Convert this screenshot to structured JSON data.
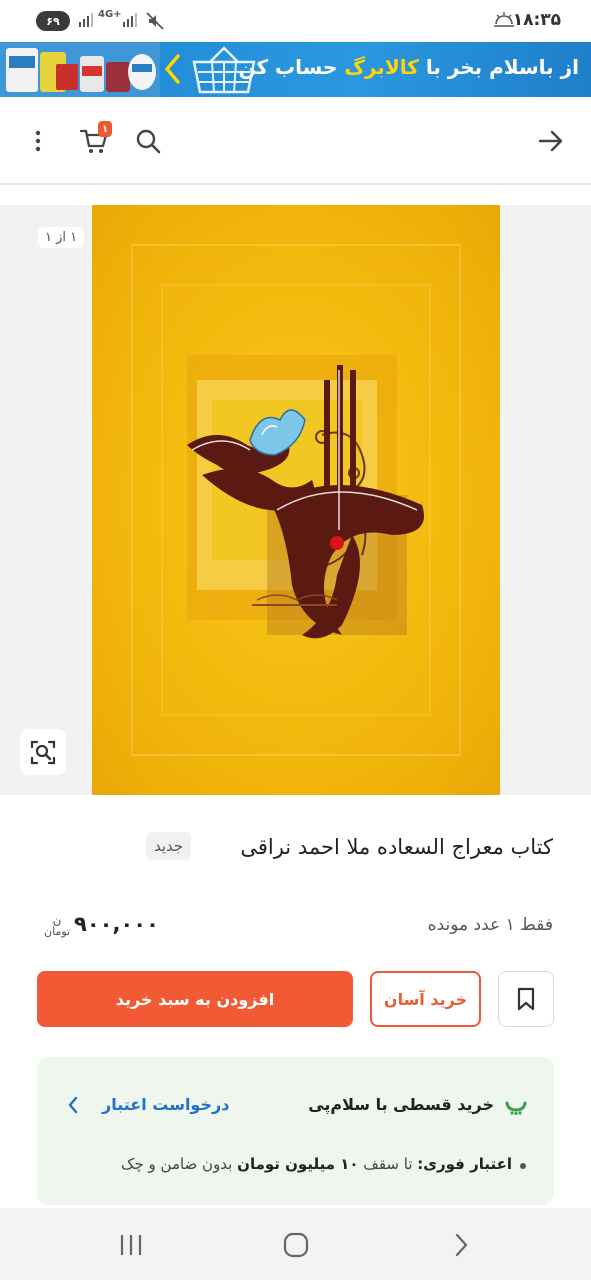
{
  "status_bar": {
    "time": "۱۸:۳۵",
    "battery": "۶۹",
    "network": "4G+"
  },
  "banner": {
    "text_prefix": "از باسلام بخر با ",
    "text_highlight": "کالابرگ",
    "text_suffix": " حساب کن"
  },
  "app_bar": {
    "cart_count": "۱"
  },
  "gallery": {
    "counter": "۱ از ۱"
  },
  "product": {
    "title": "کتاب معراج السعاده ملا احمد نراقی",
    "badge": "جدید",
    "stock": "فقط ۱ عدد مونده",
    "price": "۹۰۰,۰۰۰",
    "currency_top": "ن",
    "currency_bottom": "تومان"
  },
  "actions": {
    "add_to_cart": "افزودن به سبد خرید",
    "easy_buy": "خرید آسان"
  },
  "installment": {
    "title": "خرید قسطی با سلام‌پی",
    "credit_link": "درخواست اعتبار",
    "detail_label": "اعتبار فوری:",
    "detail_pre": " تا سقف ",
    "detail_amount": "۱۰ میلیون تومان",
    "detail_post": " بدون ضامن و چک"
  },
  "colors": {
    "accent": "#f25a35",
    "banner": "#1d86d1",
    "link": "#1f72c7",
    "card_bg": "#eef6ee"
  }
}
